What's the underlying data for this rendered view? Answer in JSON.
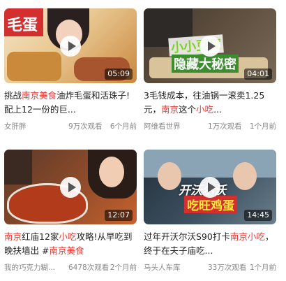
{
  "videos": [
    {
      "thumb_text": "毛蛋",
      "duration": "05:09",
      "title_parts": [
        {
          "text": "挑战",
          "hl": false
        },
        {
          "text": "南京美食",
          "hl": true
        },
        {
          "text": "油炸毛蛋和活珠子!配上12一份的巨...",
          "hl": false
        }
      ],
      "channel": "女肝胖",
      "views": "9万次观看",
      "time": "6个月前"
    },
    {
      "thumb_text_1": "小小豆腐",
      "thumb_text_2": "隐藏大秘密",
      "duration": "04:01",
      "title_parts": [
        {
          "text": "3毛钱成本，往油锅一滚卖1.25元，",
          "hl": false
        },
        {
          "text": "南京",
          "hl": true
        },
        {
          "text": "这个",
          "hl": false
        },
        {
          "text": "小吃",
          "hl": true
        },
        {
          "text": "...",
          "hl": false
        }
      ],
      "channel": "阿维看世界",
      "views": "1万次观看",
      "time": "1个月前"
    },
    {
      "duration": "12:07",
      "title_parts": [
        {
          "text": "南京",
          "hl": true
        },
        {
          "text": "红庙12家",
          "hl": false
        },
        {
          "text": "小吃",
          "hl": true
        },
        {
          "text": "攻略!从早吃到晚扶墙出 #",
          "hl": false
        },
        {
          "text": "南京美食",
          "hl": true
        }
      ],
      "channel": "我的巧克力糊...",
      "views": "6478次观看",
      "time": "2个月前"
    },
    {
      "thumb_text_1": "开沃尔沃",
      "thumb_text_2": "吃旺鸡蛋",
      "duration": "14:45",
      "title_parts": [
        {
          "text": "过年开沃尔沃S90打卡",
          "hl": false
        },
        {
          "text": "南京小吃",
          "hl": true
        },
        {
          "text": "，终于在夫子庙吃...",
          "hl": false
        }
      ],
      "channel": "马头人车库",
      "views": "33万次观看",
      "time": "1个月前"
    }
  ],
  "colors": {
    "highlight": "#e53935",
    "meta": "#888888",
    "title": "#222222"
  },
  "icons": [
    "play-icon"
  ]
}
